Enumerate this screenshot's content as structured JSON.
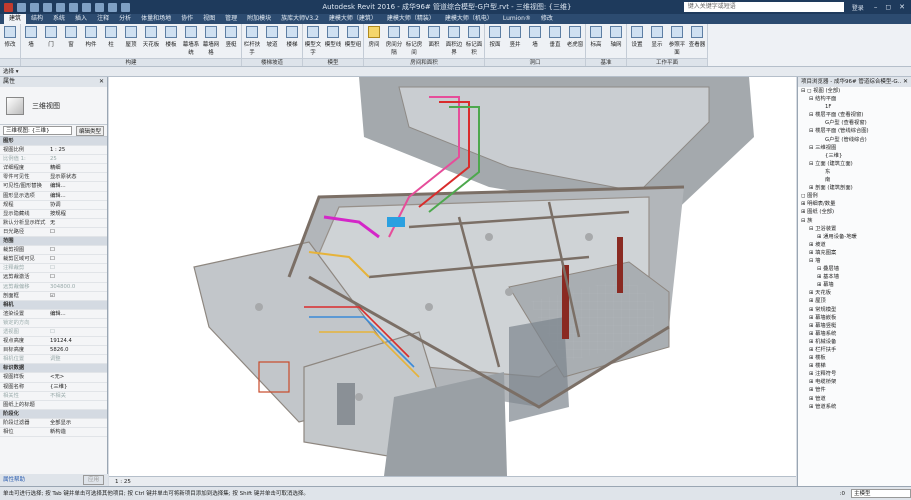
{
  "app": {
    "title": "Autodesk Revit 2016 - 成华96# 管道综合模型-G户型.rvt - 三维视图: {三维}",
    "search_placeholder": "键入关键字或短语",
    "user": "登录"
  },
  "ribbon_tabs": [
    "建筑",
    "结构",
    "系统",
    "插入",
    "注释",
    "分析",
    "体量和场地",
    "协作",
    "视图",
    "管理",
    "附加模块",
    "族库大师V3.2",
    "建模大师（建筑）",
    "建模大师（精装）",
    "建模大师（机电）",
    "Lumion®",
    "修改"
  ],
  "active_tab_index": 0,
  "ribbon": {
    "groups": [
      {
        "label": "",
        "buttons": [
          "修改"
        ]
      },
      {
        "label": "构建",
        "buttons": [
          "墙",
          "门",
          "窗",
          "构件",
          "柱",
          "屋顶",
          "天花板",
          "楼板",
          "幕墙系统",
          "幕墙网格",
          "竖梃"
        ]
      },
      {
        "label": "楼梯坡道",
        "buttons": [
          "栏杆扶手",
          "坡道",
          "楼梯"
        ]
      },
      {
        "label": "模型",
        "buttons": [
          "模型文字",
          "模型线",
          "模型组"
        ]
      },
      {
        "label": "房间和面积",
        "buttons": [
          "房间",
          "房间分隔",
          "标记房间",
          "面积",
          "面积边界",
          "标记面积"
        ]
      },
      {
        "label": "洞口",
        "buttons": [
          "按面",
          "竖井",
          "墙",
          "垂直",
          "老虎窗"
        ]
      },
      {
        "label": "基准",
        "buttons": [
          "标高",
          "轴网"
        ]
      },
      {
        "label": "工作平面",
        "buttons": [
          "设置",
          "显示",
          "参照平面",
          "查看器"
        ]
      }
    ],
    "select_label": "选择 ▾"
  },
  "properties": {
    "title": "属性",
    "type_name": "三维视图",
    "filter": "三维视图: {三维}",
    "edit_type": "编辑类型",
    "rows": [
      {
        "k": "图形",
        "v": "",
        "group": true
      },
      {
        "k": "视图比例",
        "v": "1 : 25"
      },
      {
        "k": "比例值 1:",
        "v": "25",
        "dim": true
      },
      {
        "k": "详细程度",
        "v": "精细"
      },
      {
        "k": "零件可见性",
        "v": "显示原状态"
      },
      {
        "k": "可见性/图形替换",
        "v": "编辑..."
      },
      {
        "k": "图形显示选项",
        "v": "编辑..."
      },
      {
        "k": "规程",
        "v": "协调"
      },
      {
        "k": "显示隐藏线",
        "v": "按规程"
      },
      {
        "k": "默认分析显示样式",
        "v": "无"
      },
      {
        "k": "日光路径",
        "v": "☐"
      },
      {
        "k": "范围",
        "v": "",
        "group": true
      },
      {
        "k": "裁剪视图",
        "v": "☐"
      },
      {
        "k": "裁剪区域可见",
        "v": "☐"
      },
      {
        "k": "注释裁剪",
        "v": "☐",
        "dim": true
      },
      {
        "k": "远剪裁激活",
        "v": "☐"
      },
      {
        "k": "远剪裁偏移",
        "v": "304800.0",
        "dim": true
      },
      {
        "k": "剖面框",
        "v": "☑"
      },
      {
        "k": "相机",
        "v": "",
        "group": true
      },
      {
        "k": "渲染设置",
        "v": "编辑..."
      },
      {
        "k": "锁定的方向",
        "v": "",
        "dim": true
      },
      {
        "k": "透视图",
        "v": "☐",
        "dim": true
      },
      {
        "k": "视点高度",
        "v": "19124.4"
      },
      {
        "k": "目标高度",
        "v": "5826.0"
      },
      {
        "k": "相机位置",
        "v": "调整",
        "dim": true
      },
      {
        "k": "标识数据",
        "v": "",
        "group": true
      },
      {
        "k": "视图样板",
        "v": "<无>"
      },
      {
        "k": "视图名称",
        "v": "{三维}"
      },
      {
        "k": "相关性",
        "v": "不相关",
        "dim": true
      },
      {
        "k": "图纸上的标题",
        "v": ""
      },
      {
        "k": "阶段化",
        "v": "",
        "group": true
      },
      {
        "k": "阶段过滤器",
        "v": "全部显示"
      },
      {
        "k": "相位",
        "v": "新构造"
      }
    ],
    "help": "属性帮助",
    "apply": "应用"
  },
  "browser": {
    "title": "项目浏览器 - 成华96# 管道综合模型-G...",
    "items": [
      {
        "t": "⊟ ◻ 视图 (全部)",
        "l": 0
      },
      {
        "t": "⊟ 结构平面",
        "l": 1
      },
      {
        "t": "1F",
        "l": 3
      },
      {
        "t": "⊟ 楼层平面 (查看视窗)",
        "l": 1
      },
      {
        "t": "G户型 (查看视窗)",
        "l": 3
      },
      {
        "t": "⊟ 楼层平面 (管线综合图)",
        "l": 1
      },
      {
        "t": "G户型 (管线综合)",
        "l": 3
      },
      {
        "t": "⊟ 三维视图",
        "l": 1
      },
      {
        "t": "{三维}",
        "l": 3
      },
      {
        "t": "⊟ 立面 (建筑立面)",
        "l": 1
      },
      {
        "t": "东",
        "l": 3
      },
      {
        "t": "南",
        "l": 3
      },
      {
        "t": "⊞ 剖面 (建筑剖面)",
        "l": 1
      },
      {
        "t": "◻ 图例",
        "l": 0
      },
      {
        "t": "⊞ 明细表/数量",
        "l": 0
      },
      {
        "t": "⊞ 图纸 (全部)",
        "l": 0
      },
      {
        "t": "⊟ 族",
        "l": 0
      },
      {
        "t": "⊟ 卫浴装置",
        "l": 1
      },
      {
        "t": "⊞ 通用设备-地暖",
        "l": 2
      },
      {
        "t": "⊞ 坡道",
        "l": 1
      },
      {
        "t": "⊞ 填充图案",
        "l": 1
      },
      {
        "t": "⊟ 墙",
        "l": 1
      },
      {
        "t": "⊟ 叠层墙",
        "l": 2
      },
      {
        "t": "⊞ 基本墙",
        "l": 2
      },
      {
        "t": "⊞ 幕墙",
        "l": 2
      },
      {
        "t": "⊞ 天花板",
        "l": 1
      },
      {
        "t": "⊞ 屋顶",
        "l": 1
      },
      {
        "t": "⊞ 常规模型",
        "l": 1
      },
      {
        "t": "⊞ 幕墙嵌板",
        "l": 1
      },
      {
        "t": "⊞ 幕墙竖梃",
        "l": 1
      },
      {
        "t": "⊞ 幕墙系统",
        "l": 1
      },
      {
        "t": "⊞ 机械设备",
        "l": 1
      },
      {
        "t": "⊞ 栏杆扶手",
        "l": 1
      },
      {
        "t": "⊞ 楼板",
        "l": 1
      },
      {
        "t": "⊞ 楼梯",
        "l": 1
      },
      {
        "t": "⊞ 注释符号",
        "l": 1
      },
      {
        "t": "⊞ 电缆桥架",
        "l": 1
      },
      {
        "t": "⊞ 管件",
        "l": 1
      },
      {
        "t": "⊞ 管道",
        "l": 1
      },
      {
        "t": "⊞ 管道系统",
        "l": 1
      }
    ]
  },
  "viewbar": {
    "scale": "1 : 25"
  },
  "status": {
    "message": "单击可进行选择; 按 Tab 键并单击可选择其他项目; 按 Ctrl 键并单击可将新项目添加到选择集; 按 Shift 键并单击可取消选择。",
    "count": ":0",
    "workset": "主模型"
  }
}
